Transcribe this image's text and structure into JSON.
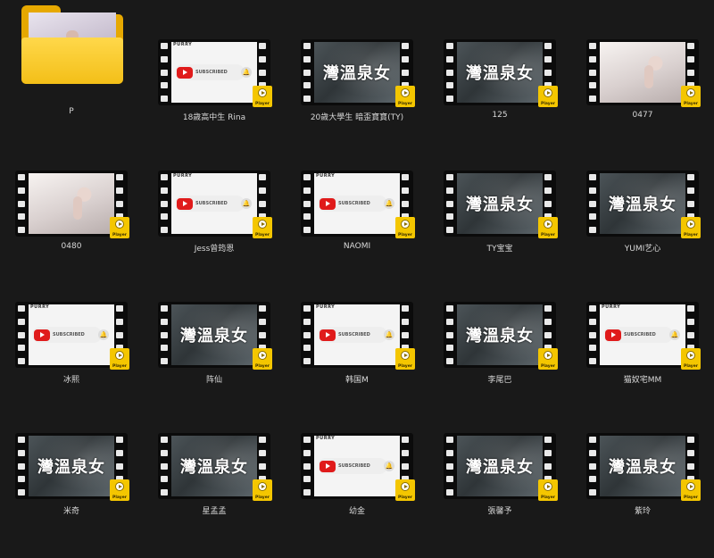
{
  "folder": {
    "label": "P",
    "icon": "folder-icon"
  },
  "badge_label": "Player",
  "sub_head": "PURRY",
  "subscribe_text": "SUBSCRIBED",
  "banner_text": "灣溫泉女",
  "items": [
    {
      "label": "18歲高中生 Rina",
      "thumb": "subscribe"
    },
    {
      "label": "20歲大學生 暗歪寶寶(TY)",
      "thumb": "banner"
    },
    {
      "label": "125",
      "thumb": "banner"
    },
    {
      "label": "0477",
      "thumb": "photo"
    },
    {
      "label": "0480",
      "thumb": "photo"
    },
    {
      "label": "Jess曾筠恩",
      "thumb": "subscribe"
    },
    {
      "label": "NAOMI",
      "thumb": "subscribe"
    },
    {
      "label": "TY宝宝",
      "thumb": "banner"
    },
    {
      "label": "YUMI艺心",
      "thumb": "banner"
    },
    {
      "label": "冰熙",
      "thumb": "subscribe"
    },
    {
      "label": "阵仙",
      "thumb": "banner"
    },
    {
      "label": "韩国M",
      "thumb": "subscribe"
    },
    {
      "label": "李尾巴",
      "thumb": "banner"
    },
    {
      "label": "猫奴宅MM",
      "thumb": "subscribe"
    },
    {
      "label": "米奇",
      "thumb": "banner"
    },
    {
      "label": "星孟孟",
      "thumb": "banner"
    },
    {
      "label": "幼金",
      "thumb": "subscribe"
    },
    {
      "label": "張馨予",
      "thumb": "banner"
    },
    {
      "label": "紫玲",
      "thumb": "banner"
    }
  ]
}
